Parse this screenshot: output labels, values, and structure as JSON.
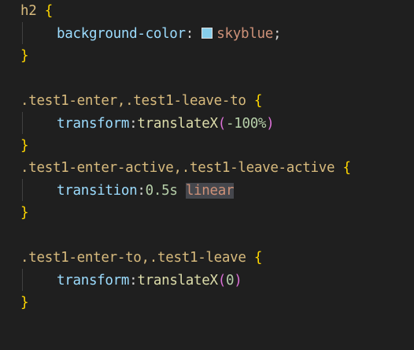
{
  "code": {
    "line1": {
      "selector": "h2",
      "brace_open": "{"
    },
    "line2": {
      "property": "background-color",
      "colon": ":",
      "swatch_color": "#87ceeb",
      "value": "skyblue",
      "semicolon": ";"
    },
    "line3": {
      "brace_close": "}"
    },
    "line5": {
      "selector": ".test1-enter,.test1-leave-to",
      "brace_open": "{"
    },
    "line6": {
      "property": "transform",
      "colon": ":",
      "function": "translateX",
      "paren_open": "(",
      "value": "-100%",
      "paren_close": ")"
    },
    "line7": {
      "brace_close": "}"
    },
    "line8": {
      "selector": ".test1-enter-active,.test1-leave-active",
      "brace_open": "{"
    },
    "line9": {
      "property": "transition",
      "colon": ":",
      "number": "0.5s",
      "keyword": "linear"
    },
    "line10": {
      "brace_close": "}"
    },
    "line12": {
      "selector": ".test1-enter-to,.test1-leave",
      "brace_open": "{"
    },
    "line13": {
      "property": "transform",
      "colon": ":",
      "function": "translateX",
      "paren_open": "(",
      "value": "0",
      "paren_close": ")"
    },
    "line14": {
      "brace_close": "}"
    }
  }
}
